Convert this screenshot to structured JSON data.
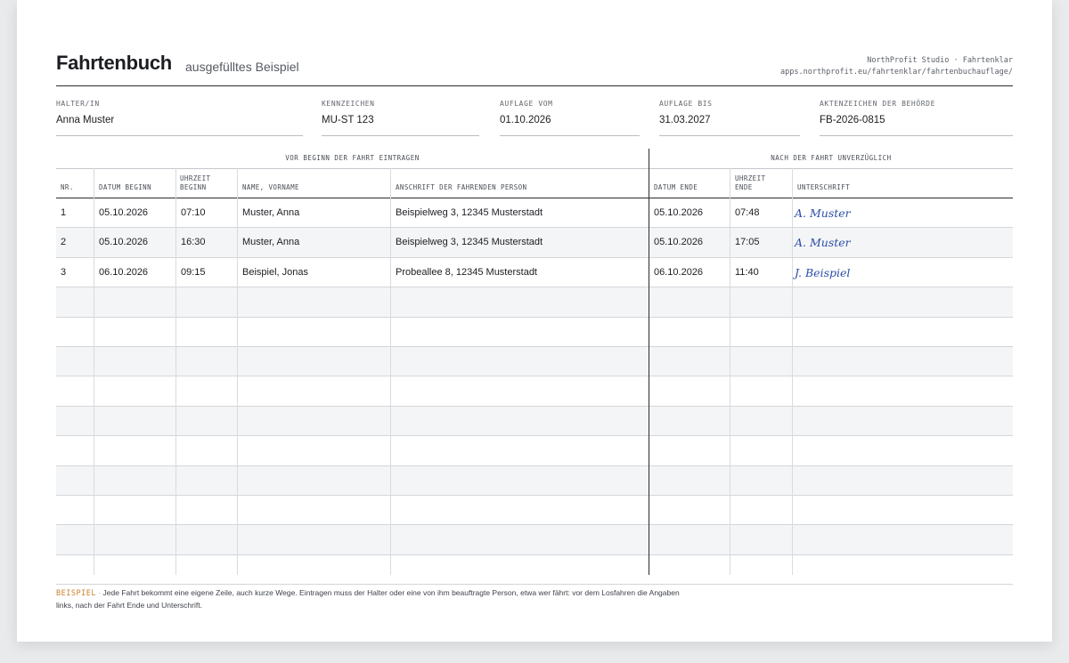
{
  "header": {
    "title": "Fahrtenbuch",
    "subtitle": "ausgefülltes Beispiel",
    "brand_line1": "NorthProfit Studio · Fahrtenklar",
    "brand_line2": "apps.northprofit.eu/fahrtenklar/fahrtenbuchauflage/"
  },
  "fields": [
    {
      "label": "HALTER/IN",
      "value": "Anna Muster"
    },
    {
      "label": "KENNZEICHEN",
      "value": "MU-ST 123"
    },
    {
      "label": "AUFLAGE VOM",
      "value": "01.10.2026"
    },
    {
      "label": "AUFLAGE BIS",
      "value": "31.03.2027"
    },
    {
      "label": "AKTENZEICHEN DER BEHÖRDE",
      "value": "FB-2026-0815"
    }
  ],
  "table": {
    "group_before": "VOR BEGINN DER FAHRT EINTRAGEN",
    "group_after": "NACH DER FAHRT UNVERZÜGLICH",
    "columns": {
      "nr": "NR.",
      "datum_beginn": "DATUM BEGINN",
      "uhrzeit_beginn_1": "UHRZEIT",
      "uhrzeit_beginn_2": "BEGINN",
      "name": "NAME, VORNAME",
      "anschrift": "ANSCHRIFT DER FAHRENDEN PERSON",
      "datum_ende": "DATUM ENDE",
      "uhrzeit_ende_1": "UHRZEIT",
      "uhrzeit_ende_2": "ENDE",
      "unterschrift": "UNTERSCHRIFT"
    },
    "rows": [
      {
        "nr": "1",
        "datum_beginn": "05.10.2026",
        "uhrzeit_beginn": "07:10",
        "name": "Muster, Anna",
        "anschrift": "Beispielweg 3, 12345 Musterstadt",
        "datum_ende": "05.10.2026",
        "uhrzeit_ende": "07:48",
        "unterschrift": "A. Muster"
      },
      {
        "nr": "2",
        "datum_beginn": "05.10.2026",
        "uhrzeit_beginn": "16:30",
        "name": "Muster, Anna",
        "anschrift": "Beispielweg 3, 12345 Musterstadt",
        "datum_ende": "05.10.2026",
        "uhrzeit_ende": "17:05",
        "unterschrift": "A. Muster"
      },
      {
        "nr": "3",
        "datum_beginn": "06.10.2026",
        "uhrzeit_beginn": "09:15",
        "name": "Beispiel, Jonas",
        "anschrift": "Probeallee 8, 12345 Musterstadt",
        "datum_ende": "06.10.2026",
        "uhrzeit_ende": "11:40",
        "unterschrift": "J. Beispiel"
      },
      {},
      {},
      {},
      {},
      {},
      {},
      {},
      {},
      {},
      {}
    ]
  },
  "footer": {
    "tag": "BEISPIEL",
    "separator": "·",
    "text": "Jede Fahrt bekommt eine eigene Zeile, auch kurze Wege. Eintragen muss der Halter oder eine von ihm beauftragte Person, etwa wer fährt: vor dem Losfahren die Angaben links, nach der Fahrt Ende und Unterschrift."
  },
  "colors": {
    "accent": "#c9822a",
    "signature": "#2c4ea6",
    "row_alt": "#f4f5f7"
  }
}
